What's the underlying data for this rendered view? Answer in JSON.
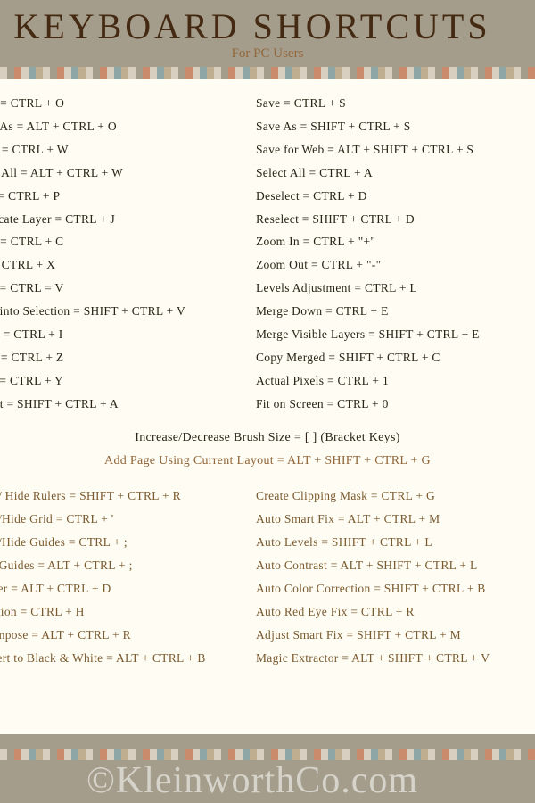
{
  "header": {
    "title": "KEYBOARD SHORTCUTS",
    "subtitle": "For PC Users"
  },
  "top_left": [
    "Open = CTRL + O",
    "Open As = ALT + CTRL + O",
    "Close = CTRL + W",
    "Close All = ALT + CTRL + W",
    "Print = CTRL + P",
    "Duplicate Layer = CTRL + J",
    "Copy = CTRL + C",
    "Cut = CTRL + X",
    "Paste = CTRL = V",
    "Paste into Selection = SHIFT + CTRL + V",
    "Invert = CTRL + I",
    "Undo = CTRL + Z",
    "Redo = CTRL + Y",
    "Revert = SHIFT + CTRL + A"
  ],
  "top_right": [
    "Save = CTRL + S",
    "Save As = SHIFT + CTRL + S",
    "Save for Web = ALT + SHIFT + CTRL + S",
    "Select All = CTRL + A",
    "Deselect = CTRL + D",
    "Reselect = SHIFT + CTRL + D",
    "Zoom In = CTRL +  \"+\"",
    "Zoom Out = CTRL +  \"-\"",
    "Levels Adjustment = CTRL + L",
    "Merge Down =  CTRL + E",
    "Merge Visible Layers = SHIFT + CTRL + E",
    "Copy Merged = SHIFT + CTRL + C",
    "Actual Pixels = CTRL + 1",
    "Fit on Screen = CTRL + 0"
  ],
  "center": {
    "line1": "Increase/Decrease Brush Size =  [    ]  (Bracket Keys)",
    "line2": "Add Page Using Current Layout = ALT + SHIFT + CTRL + G"
  },
  "bottom_left": [
    "Show/ Hide Rulers = SHIFT + CTRL + R",
    "Show/Hide Grid = CTRL + '",
    "Show/Hide Guides = CTRL + ;",
    "Lock Guides = ALT + CTRL + ;",
    "Feather = ALT + CTRL + D",
    "Selection = CTRL + H",
    "Recompose = ALT + CTRL + R",
    "Convert to Black & White = ALT + CTRL + B"
  ],
  "bottom_right": [
    "Create Clipping Mask = CTRL + G",
    "Auto Smart Fix = ALT + CTRL + M",
    "Auto Levels = SHIFT + CTRL + L",
    "Auto Contrast = ALT + SHIFT + CTRL + L",
    "Auto Color Correction = SHIFT + CTRL + B",
    "Auto Red Eye Fix = CTRL + R",
    "Adjust Smart Fix = SHIFT + CTRL + M",
    "Magic Extractor = ALT + SHIFT + CTRL + V"
  ],
  "watermark": "©KleinworthCo.com"
}
